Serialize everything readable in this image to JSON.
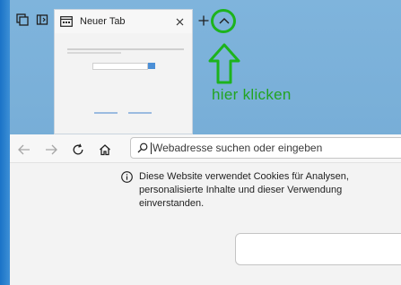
{
  "tab": {
    "title": "Neuer Tab"
  },
  "annotation": {
    "text": "hier klicken",
    "color": "#22a422"
  },
  "address_bar": {
    "placeholder": "Webadresse suchen oder eingeben"
  },
  "cookie_notice": {
    "text": "Diese Website verwendet Cookies für Analysen, personalisierte Inhalte und dieser Verwendung einverstanden."
  },
  "icons": {
    "tab_actions": "tab-actions-icon",
    "vertical_tabs": "vertical-tabs-icon",
    "tab_favicon": "new-tab-page-icon",
    "tab_close": "close-icon",
    "new_tab": "plus-icon",
    "collapse_tabs": "chevron-up-icon",
    "back": "back-arrow-icon",
    "forward": "forward-arrow-icon",
    "refresh": "refresh-icon",
    "home": "home-icon",
    "search": "search-icon",
    "info": "info-icon",
    "annotation_arrow": "arrow-up-icon"
  },
  "colors": {
    "desktop_bg": "#79afd8",
    "annotation": "#1db31d",
    "toolbar_bg": "#f7f7f7",
    "page_bg": "#f3f3f3"
  }
}
